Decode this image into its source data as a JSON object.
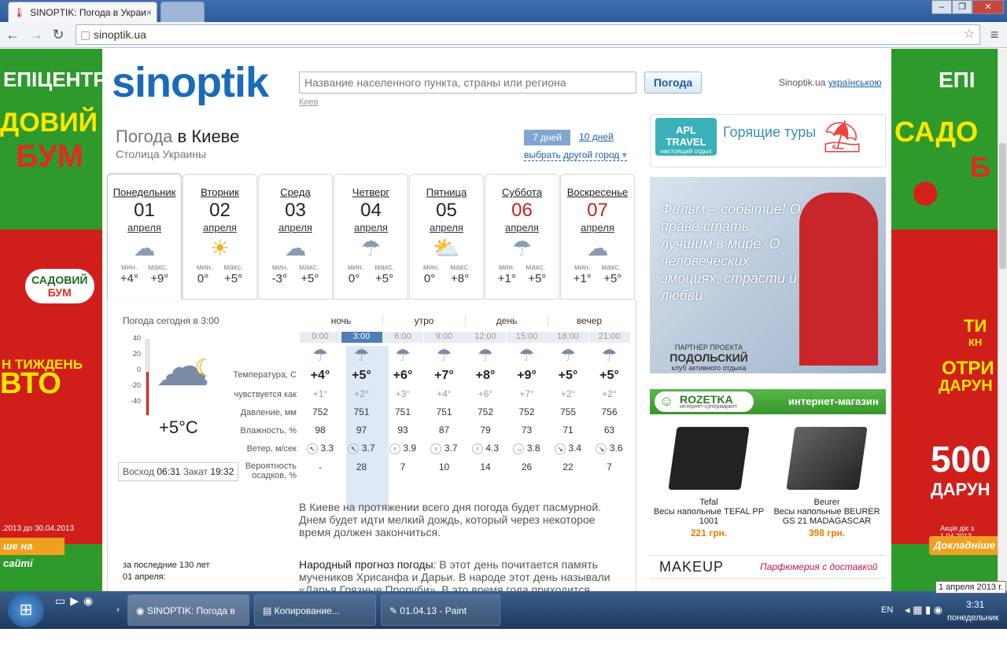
{
  "browser": {
    "tab_title": "SINOPTIK: Погода в Украи",
    "url": "sinoptik.ua"
  },
  "header": {
    "logo_text": "sinoptik",
    "search_placeholder": "Название населенного пункта, страны или региона",
    "search_button": "Погода",
    "recent_city": "Киев",
    "lang_prefix": "Sinoptik.ua",
    "lang_link": "українською"
  },
  "title": {
    "prefix": "Погода",
    "city": "в Киеве",
    "subtitle": "Столица Украины",
    "tab_7": "7 дней",
    "tab_10": "10 дней",
    "change_city": "выбрать другой город"
  },
  "days": [
    {
      "name": "Понедельник",
      "date": "01",
      "month": "апреля",
      "icon": "☁",
      "min": "+4°",
      "max": "+9°"
    },
    {
      "name": "Вторник",
      "date": "02",
      "month": "апреля",
      "icon": "☀",
      "min": "0°",
      "max": "+5°"
    },
    {
      "name": "Среда",
      "date": "03",
      "month": "апреля",
      "icon": "☁",
      "min": "-3°",
      "max": "+5°"
    },
    {
      "name": "Четверг",
      "date": "04",
      "month": "апреля",
      "icon": "☂",
      "min": "0°",
      "max": "+5°"
    },
    {
      "name": "Пятница",
      "date": "05",
      "month": "апреля",
      "icon": "⛅",
      "min": "0°",
      "max": "+8°"
    },
    {
      "name": "Суббота",
      "date": "06",
      "month": "апреля",
      "icon": "☂",
      "min": "+1°",
      "max": "+5°"
    },
    {
      "name": "Воскресенье",
      "date": "07",
      "month": "апреля",
      "icon": "☁",
      "min": "+1°",
      "max": "+5°"
    }
  ],
  "min_label": "мин.",
  "max_label": "макс.",
  "today": {
    "caption": "Погода сегодня в 3:00",
    "temp": "+5°C",
    "scale": [
      "40",
      "20",
      "0",
      "-20",
      "-40"
    ],
    "sunrise_label": "Восход",
    "sunrise": "06:31",
    "sunset_label": "Закат",
    "sunset": "19:32"
  },
  "periods": [
    "ночь",
    "утро",
    "день",
    "вечер"
  ],
  "times": [
    "0:00",
    "3:00",
    "6:00",
    "9:00",
    "12:00",
    "15:00",
    "18:00",
    "21:00"
  ],
  "row_labels": {
    "temp": "Температура, С",
    "feels": "чувствуется как",
    "pressure": "Давление, мм",
    "humidity": "Влажность, %",
    "wind": "Ветер, м/сек",
    "precip1": "Вероятность",
    "precip2": "осадков, %"
  },
  "hourly": {
    "temp": [
      "+4°",
      "+5°",
      "+6°",
      "+7°",
      "+8°",
      "+9°",
      "+5°",
      "+5°"
    ],
    "feels": [
      "+1°",
      "+2°",
      "+3°",
      "+4°",
      "+6°",
      "+7°",
      "+2°",
      "+2°"
    ],
    "pressure": [
      "752",
      "751",
      "751",
      "751",
      "752",
      "752",
      "755",
      "756"
    ],
    "humidity": [
      "98",
      "97",
      "93",
      "87",
      "79",
      "73",
      "71",
      "63"
    ],
    "wind_dir": [
      "↖",
      "↖",
      "↑",
      "↑",
      "↑",
      "→",
      "↘",
      "↘"
    ],
    "wind": [
      "3.3",
      "3.7",
      "3.9",
      "3.7",
      "4.3",
      "3.8",
      "3.4",
      "3.6"
    ],
    "precip": [
      "-",
      "28",
      "7",
      "10",
      "14",
      "26",
      "22",
      "7"
    ]
  },
  "description": "В Киеве на протяжении всего дня погода будет пасмурной. Днем будет идти мелкий дождь, который через некоторое время должен закончиться.",
  "folk": {
    "title": "Народный прогноз погоды",
    "text": ": В этот день почитается память мучеников Хрисанфа и Дарьи. В народе этот день называли «Дарья Грязные Проруби». В это время года приходится"
  },
  "history": {
    "line1": "за последние 130 лет",
    "line2": "01 апреля:"
  },
  "ads": {
    "tours_logo": "APL TRAVEL",
    "tours_sub": "настоящий отдых",
    "tours_text": "Горящие туры",
    "banner_text": "Фильм – событие! О праве стать лучшим в мире. О человеческих эмоциях, страсти и любви",
    "banner_partner_label": "ПАРТНЁР ПРОЕКТА",
    "banner_partner": "ПОДОЛЬСКИЙ",
    "banner_partner_sub": "клуб активного отдыха",
    "rozetka": "ROZETKA",
    "rozetka_sub": "интернет-супермаркет",
    "rozetka_tag": "интернет-магазин",
    "products": [
      {
        "brand": "Tefal",
        "name": "Весы напольные TEFAL PP 1001",
        "price": "221 грн."
      },
      {
        "brand": "Beurer",
        "name": "Весы напольные BEURER GS 21 MADAGASCAR",
        "price": "398 грн."
      }
    ],
    "makeup": "MAKEUP",
    "makeup_tag": "Парфюмерия с доставкой",
    "left_brand": "ЕПІЦЕНТР",
    "left_big1": "ДОВИЙ",
    "left_big2": "БУМ",
    "left_promo1": "САДОВИЙ",
    "left_promo2": "БУМ",
    "left_week": "Н ТИЖДЕНЬ",
    "left_auto": "ВТО",
    "left_date": ".2013 до 30.04.2013",
    "left_btn": "ше на сайті",
    "right_brand": "ЕПІ",
    "right_big1": "САДО",
    "right_big2": "Б",
    "right_ti": "ТИ",
    "right_kn": "КН",
    "right_otri": "ОТРИ",
    "right_darun": "ДАРУН",
    "right_500": "500",
    "right_darun2": "ДАРУН",
    "right_date": "Акція діє з 1.04.2013",
    "right_btn": "Докладніше"
  },
  "taskbar": {
    "item1": "SINOPTIK: Погода в ...",
    "item2": "Копирование...",
    "item3": "01.04.13 - Paint",
    "lang": "EN",
    "time": "3:31",
    "day": "понедельник",
    "tooltip": "1 апреля 2013 г."
  }
}
